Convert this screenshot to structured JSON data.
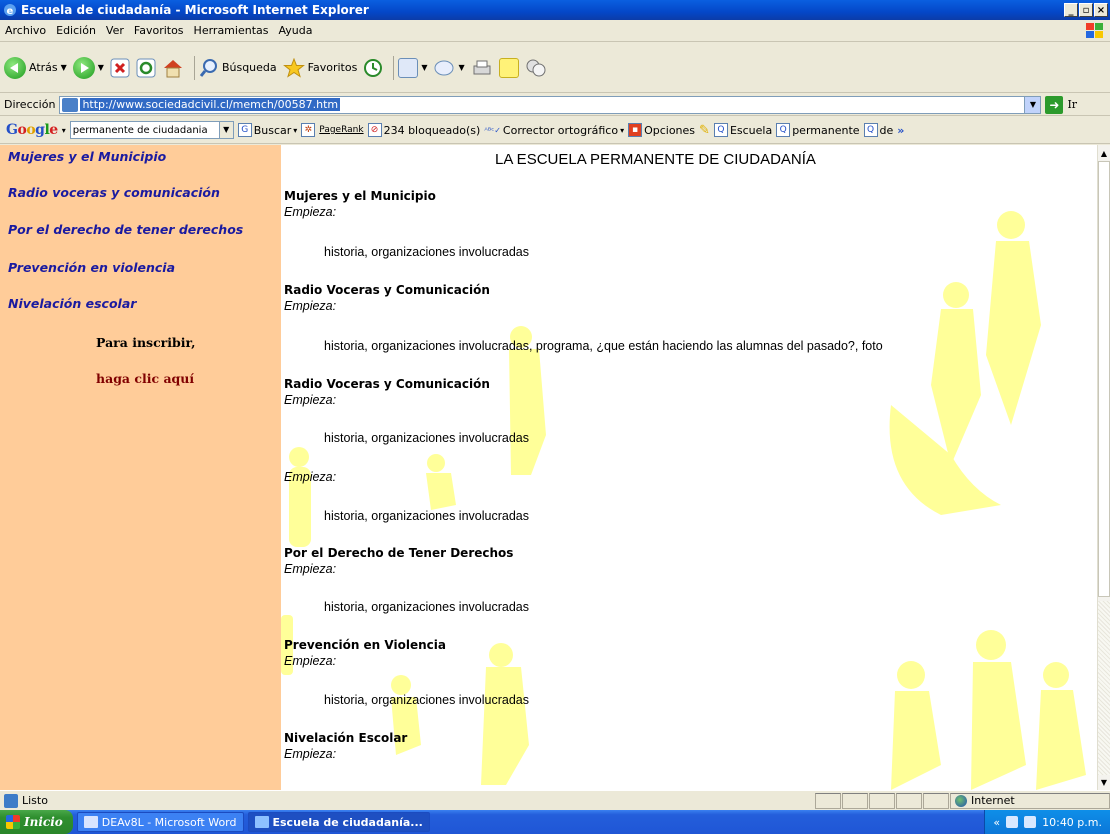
{
  "window": {
    "title": "Escuela de ciudadanía - Microsoft Internet Explorer",
    "controls": [
      "_",
      "̅",
      "X"
    ]
  },
  "menu": [
    "Archivo",
    "Edición",
    "Ver",
    "Favoritos",
    "Herramientas",
    "Ayuda"
  ],
  "toolbar": {
    "back_label": "Atrás",
    "search_label": "Búsqueda",
    "favorites_label": "Favoritos"
  },
  "address": {
    "label": "Dirección",
    "url": "http://www.sociedadcivil.cl/memch/00587.htm",
    "go_label": "Ir"
  },
  "google_bar": {
    "query": "permanente de ciudadania",
    "search_label": "Buscar",
    "pagerank_label": "PageRank",
    "blocked_label": "234 bloqueado(s)",
    "spell_label": "Corrector ortográfico",
    "options_label": "Opciones",
    "hl1": "Escuela",
    "hl2": "permanente",
    "hl3": "de",
    "more": "»"
  },
  "sidebar": {
    "links": [
      "Mujeres y el Municipio",
      "Radio voceras y comunicación",
      "Por el derecho de tener derechos",
      "Prevención en violencia",
      "Nivelación escolar"
    ],
    "cta_line1": "Para inscribir,",
    "cta_line2": "haga clic aquí"
  },
  "content": {
    "page_title": "LA ESCUELA PERMANENTE DE CIUDADANÍA",
    "start_label": "Empieza:",
    "sections": [
      {
        "title": "Mujeres y el Municipio",
        "body": "historia, organizaciones involucradas"
      },
      {
        "title": "Radio Voceras y Comunicación",
        "body": "historia, organizaciones involucradas, programa, ¿que están haciendo las alumnas del pasado?, foto"
      },
      {
        "title": "Radio Voceras y Comunicación",
        "body": "historia, organizaciones involucradas"
      },
      {
        "title": "",
        "body": "historia, organizaciones involucradas"
      },
      {
        "title": "Por el Derecho de Tener Derechos",
        "body": "historia, organizaciones involucradas"
      },
      {
        "title": "Prevención en Violencia",
        "body": "historia, organizaciones involucradas"
      },
      {
        "title": "Nivelación Escolar",
        "body": ""
      }
    ]
  },
  "status": {
    "text": "Listo",
    "zone": "Internet"
  },
  "taskbar": {
    "start": "Inicio",
    "task1": "DEAv8L - Microsoft Word",
    "task2": "Escuela de ciudadanía...",
    "tray_arrows": "«",
    "clock": "10:40 p.m."
  },
  "colors": {
    "sidebar_bg": "#ffcc99",
    "sidebar_link": "#1a1aa0",
    "cta_red": "#800000",
    "watermark": "#ffff99"
  }
}
